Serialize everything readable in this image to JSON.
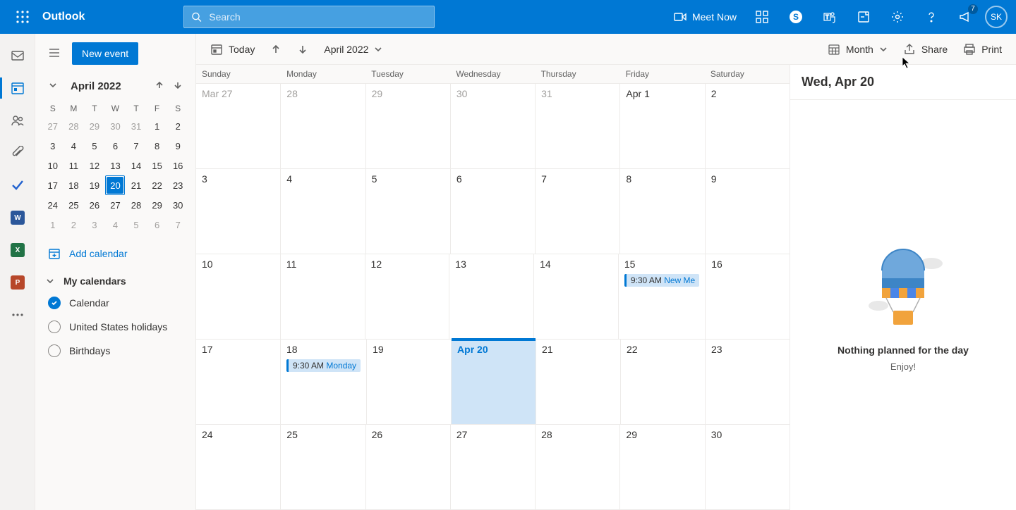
{
  "header": {
    "app_name": "Outlook",
    "search_placeholder": "Search",
    "meet_now": "Meet Now",
    "notifications_badge": "7",
    "avatar_initials": "SK"
  },
  "sidebar": {
    "new_event": "New event",
    "month_label": "April 2022",
    "dow": [
      "S",
      "M",
      "T",
      "W",
      "T",
      "F",
      "S"
    ],
    "mini_weeks": [
      [
        {
          "n": "27",
          "o": true
        },
        {
          "n": "28",
          "o": true
        },
        {
          "n": "29",
          "o": true
        },
        {
          "n": "30",
          "o": true
        },
        {
          "n": "31",
          "o": true
        },
        {
          "n": "1"
        },
        {
          "n": "2"
        }
      ],
      [
        {
          "n": "3"
        },
        {
          "n": "4"
        },
        {
          "n": "5"
        },
        {
          "n": "6"
        },
        {
          "n": "7"
        },
        {
          "n": "8"
        },
        {
          "n": "9"
        }
      ],
      [
        {
          "n": "10"
        },
        {
          "n": "11"
        },
        {
          "n": "12"
        },
        {
          "n": "13"
        },
        {
          "n": "14"
        },
        {
          "n": "15"
        },
        {
          "n": "16"
        }
      ],
      [
        {
          "n": "17"
        },
        {
          "n": "18"
        },
        {
          "n": "19"
        },
        {
          "n": "20",
          "today": true
        },
        {
          "n": "21"
        },
        {
          "n": "22"
        },
        {
          "n": "23"
        }
      ],
      [
        {
          "n": "24"
        },
        {
          "n": "25"
        },
        {
          "n": "26"
        },
        {
          "n": "27"
        },
        {
          "n": "28"
        },
        {
          "n": "29"
        },
        {
          "n": "30"
        }
      ],
      [
        {
          "n": "1",
          "o": true
        },
        {
          "n": "2",
          "o": true
        },
        {
          "n": "3",
          "o": true
        },
        {
          "n": "4",
          "o": true
        },
        {
          "n": "5",
          "o": true
        },
        {
          "n": "6",
          "o": true
        },
        {
          "n": "7",
          "o": true
        }
      ]
    ],
    "add_calendar": "Add calendar",
    "section_label": "My calendars",
    "calendars": [
      {
        "label": "Calendar",
        "checked": true
      },
      {
        "label": "United States holidays",
        "checked": false
      },
      {
        "label": "Birthdays",
        "checked": false
      }
    ]
  },
  "toolbar": {
    "today": "Today",
    "month_year": "April 2022",
    "view": "Month",
    "share": "Share",
    "print": "Print"
  },
  "grid": {
    "dow": [
      "Sunday",
      "Monday",
      "Tuesday",
      "Wednesday",
      "Thursday",
      "Friday",
      "Saturday"
    ],
    "weeks": [
      [
        {
          "label": "Mar 27",
          "o": true
        },
        {
          "label": "28",
          "o": true
        },
        {
          "label": "29",
          "o": true
        },
        {
          "label": "30",
          "o": true
        },
        {
          "label": "31",
          "o": true
        },
        {
          "label": "Apr 1"
        },
        {
          "label": "2"
        }
      ],
      [
        {
          "label": "3"
        },
        {
          "label": "4"
        },
        {
          "label": "5"
        },
        {
          "label": "6"
        },
        {
          "label": "7"
        },
        {
          "label": "8"
        },
        {
          "label": "9"
        }
      ],
      [
        {
          "label": "10"
        },
        {
          "label": "11"
        },
        {
          "label": "12"
        },
        {
          "label": "13"
        },
        {
          "label": "14"
        },
        {
          "label": "15",
          "event": {
            "time": "9:30 AM",
            "title": "New Me"
          }
        },
        {
          "label": "16"
        }
      ],
      [
        {
          "label": "17"
        },
        {
          "label": "18",
          "event": {
            "time": "9:30 AM",
            "title": "Monday"
          }
        },
        {
          "label": "19"
        },
        {
          "label": "Apr 20",
          "today": true
        },
        {
          "label": "21"
        },
        {
          "label": "22"
        },
        {
          "label": "23"
        }
      ],
      [
        {
          "label": "24"
        },
        {
          "label": "25"
        },
        {
          "label": "26"
        },
        {
          "label": "27"
        },
        {
          "label": "28"
        },
        {
          "label": "29"
        },
        {
          "label": "30"
        }
      ]
    ]
  },
  "agenda": {
    "date_label": "Wed, Apr 20",
    "empty_heading": "Nothing planned for the day",
    "empty_sub": "Enjoy!"
  }
}
